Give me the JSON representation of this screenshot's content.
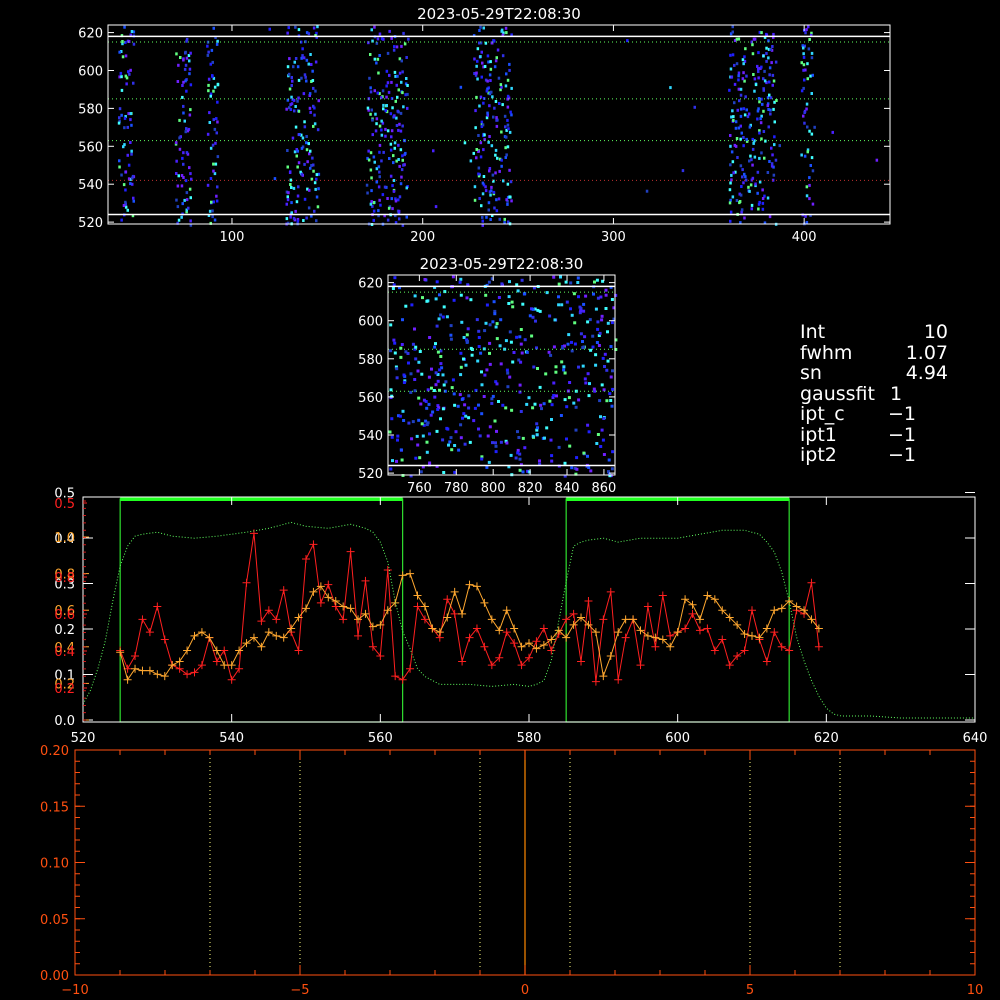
{
  "colors": {
    "background": "#000000",
    "axes": "#ffffff",
    "red_series": "#ff2020",
    "orange_series": "#ffa830",
    "green_profile": "#60ff60",
    "green_box": "#30e030",
    "green_bar": "#20ff20",
    "bottom_axes": "#ff5010",
    "bottom_line": "#ff8800",
    "guide_lines": "#ffff80",
    "dark_red_line": "#c03030"
  },
  "info": {
    "rows": [
      {
        "key": "Int",
        "value": "10"
      },
      {
        "key": "fwhm",
        "value": "1.07"
      },
      {
        "key": "sn",
        "value": "4.94"
      },
      {
        "key": "gaussfit",
        "value": "1"
      },
      {
        "key": "ipt_c",
        "value": "−1"
      },
      {
        "key": "ipt1",
        "value": "−1"
      },
      {
        "key": "ipt2",
        "value": "−1"
      }
    ]
  },
  "chart_data": [
    {
      "type": "heatmap",
      "title": "2023-05-29T22:08:30",
      "xlim": [
        35,
        445
      ],
      "ylim": [
        519,
        624
      ],
      "x_ticks": [
        "100",
        "200",
        "300",
        "400"
      ],
      "y_ticks": [
        "520",
        "540",
        "560",
        "580",
        "600",
        "620"
      ],
      "horizontal_lines_solid": [
        524,
        618
      ],
      "horizontal_lines_dotted": [
        563,
        585,
        615
      ],
      "horizontal_line_red_dotted": 542,
      "active_columns": [
        [
          40,
          48
        ],
        [
          70,
          78
        ],
        [
          86,
          92
        ],
        [
          128,
          145
        ],
        [
          170,
          192
        ],
        [
          226,
          246
        ],
        [
          360,
          385
        ],
        [
          398,
          404
        ]
      ]
    },
    {
      "type": "heatmap",
      "title": "2023-05-29T22:08:30",
      "xlim": [
        743,
        866
      ],
      "ylim": [
        519,
        624
      ],
      "x_ticks": [
        "760",
        "780",
        "800",
        "820",
        "840",
        "860"
      ],
      "y_ticks": [
        "520",
        "540",
        "560",
        "580",
        "600",
        "620"
      ],
      "horizontal_lines_solid": [
        524,
        618
      ],
      "horizontal_lines_dotted": [
        563,
        585,
        615
      ]
    },
    {
      "type": "line",
      "xlim": [
        520,
        640
      ],
      "x_ticks": [
        "520",
        "540",
        "560",
        "580",
        "600",
        "620",
        "640"
      ],
      "y_ticks_orange": [
        "0.0",
        "0.2",
        "0.4",
        "0.6",
        "0.8",
        "1.0"
      ],
      "y_ticks_red": [
        "0.2",
        "0.4",
        "0.6",
        "0.8",
        "0.5"
      ],
      "y_ticks_white": [
        "0.0",
        "0.1",
        "0.2",
        "0.3",
        "0.4",
        "0.5"
      ],
      "boxes": [
        [
          525,
          563
        ],
        [
          585,
          615
        ]
      ],
      "series": [
        {
          "color": "red",
          "x": [
            525,
            526,
            527,
            528,
            529,
            530,
            531,
            532,
            533,
            534,
            535,
            536,
            537,
            538,
            539,
            540,
            541,
            542,
            543,
            544,
            545,
            546,
            547,
            548,
            549,
            550,
            551,
            552,
            553,
            554,
            555,
            556,
            557,
            558,
            559,
            560,
            561,
            562,
            563,
            564,
            565,
            566,
            567,
            568,
            569,
            570,
            571,
            572,
            573,
            574,
            575,
            576,
            577,
            578,
            579,
            580,
            581,
            582,
            583,
            584,
            585,
            586,
            587,
            588,
            589,
            590,
            591,
            592,
            593,
            594,
            595,
            596,
            597,
            598,
            599,
            600,
            601,
            602,
            603,
            604,
            605,
            606,
            607,
            608,
            609,
            610,
            611,
            612,
            613,
            614,
            615,
            616,
            617,
            618,
            619
          ],
          "y": [
            0.38,
            0.28,
            0.35,
            0.55,
            0.48,
            0.62,
            0.44,
            0.3,
            0.28,
            0.25,
            0.26,
            0.3,
            0.45,
            0.32,
            0.38,
            0.22,
            0.28,
            0.75,
            1.02,
            0.54,
            0.6,
            0.55,
            0.71,
            0.48,
            0.38,
            0.88,
            0.96,
            0.64,
            0.74,
            0.62,
            0.55,
            0.92,
            0.46,
            0.76,
            0.4,
            0.35,
            0.82,
            0.24,
            0.22,
            0.28,
            0.62,
            0.55,
            0.5,
            0.45,
            0.66,
            0.58,
            0.32,
            0.45,
            0.5,
            0.4,
            0.3,
            0.34,
            0.48,
            0.42,
            0.3,
            0.34,
            0.43,
            0.5,
            0.38,
            0.47,
            0.55,
            0.58,
            0.32,
            0.65,
            0.21,
            0.55,
            0.7,
            0.22,
            0.45,
            0.55,
            0.3,
            0.62,
            0.4,
            0.68,
            0.46,
            0.48,
            0.5,
            0.58,
            0.49,
            0.5,
            0.38,
            0.44,
            0.3,
            0.35,
            0.38,
            0.6,
            0.44,
            0.32,
            0.48,
            0.4,
            0.38,
            0.6,
            0.58,
            0.75,
            0.4
          ]
        },
        {
          "color": "orange",
          "x": [
            525,
            526,
            527,
            528,
            529,
            530,
            531,
            532,
            533,
            534,
            535,
            536,
            537,
            538,
            539,
            540,
            541,
            542,
            543,
            544,
            545,
            546,
            547,
            548,
            549,
            550,
            551,
            552,
            553,
            554,
            555,
            556,
            557,
            558,
            559,
            560,
            561,
            562,
            563,
            564,
            565,
            566,
            567,
            568,
            569,
            570,
            571,
            572,
            573,
            574,
            575,
            576,
            577,
            578,
            579,
            580,
            581,
            582,
            583,
            584,
            585,
            586,
            587,
            588,
            589,
            590,
            591,
            592,
            593,
            594,
            595,
            596,
            597,
            598,
            599,
            600,
            601,
            602,
            603,
            604,
            605,
            606,
            607,
            608,
            609,
            610,
            611,
            612,
            613,
            614,
            615,
            616,
            617,
            618,
            619
          ],
          "y": [
            0.37,
            0.22,
            0.28,
            0.27,
            0.27,
            0.25,
            0.24,
            0.3,
            0.32,
            0.38,
            0.46,
            0.48,
            0.45,
            0.38,
            0.3,
            0.3,
            0.38,
            0.42,
            0.45,
            0.4,
            0.48,
            0.46,
            0.45,
            0.5,
            0.56,
            0.61,
            0.7,
            0.73,
            0.67,
            0.65,
            0.62,
            0.61,
            0.55,
            0.58,
            0.51,
            0.52,
            0.6,
            0.64,
            0.79,
            0.8,
            0.68,
            0.62,
            0.5,
            0.48,
            0.56,
            0.7,
            0.58,
            0.74,
            0.73,
            0.64,
            0.55,
            0.49,
            0.6,
            0.5,
            0.4,
            0.42,
            0.39,
            0.41,
            0.44,
            0.49,
            0.45,
            0.52,
            0.56,
            0.52,
            0.48,
            0.24,
            0.35,
            0.48,
            0.55,
            0.55,
            0.49,
            0.46,
            0.45,
            0.44,
            0.4,
            0.48,
            0.66,
            0.63,
            0.55,
            0.68,
            0.66,
            0.6,
            0.56,
            0.52,
            0.47,
            0.46,
            0.45,
            0.5,
            0.6,
            0.61,
            0.65,
            0.62,
            0.6,
            0.55,
            0.5
          ]
        },
        {
          "color": "green-dotted",
          "x": [
            520,
            521,
            522,
            523,
            524,
            525,
            526,
            527,
            528,
            530,
            532,
            535,
            538,
            540,
            542,
            545,
            548,
            550,
            553,
            556,
            558,
            559,
            560,
            561,
            562,
            563,
            564,
            565,
            566,
            567,
            568,
            570,
            572,
            575,
            578,
            580,
            581,
            582,
            583,
            584,
            585,
            586,
            587,
            588,
            590,
            592,
            595,
            598,
            600,
            603,
            606,
            609,
            611,
            612,
            613,
            614,
            615,
            616,
            617,
            618,
            619,
            620,
            621,
            622,
            623,
            624,
            626,
            630,
            635,
            640
          ],
          "y": [
            0.08,
            0.15,
            0.26,
            0.4,
            0.6,
            0.78,
            0.88,
            0.93,
            0.94,
            0.95,
            0.93,
            0.92,
            0.93,
            0.94,
            0.95,
            0.97,
            1.0,
            0.98,
            0.97,
            0.99,
            0.97,
            0.95,
            0.9,
            0.8,
            0.6,
            0.45,
            0.36,
            0.26,
            0.22,
            0.2,
            0.18,
            0.18,
            0.18,
            0.17,
            0.18,
            0.17,
            0.18,
            0.2,
            0.3,
            0.5,
            0.7,
            0.88,
            0.9,
            0.91,
            0.92,
            0.9,
            0.92,
            0.92,
            0.92,
            0.94,
            0.96,
            0.96,
            0.94,
            0.9,
            0.85,
            0.75,
            0.6,
            0.42,
            0.3,
            0.2,
            0.12,
            0.06,
            0.03,
            0.02,
            0.02,
            0.02,
            0.02,
            0.01,
            0.01,
            0.01
          ]
        }
      ]
    },
    {
      "type": "line",
      "xlim": [
        -10,
        10
      ],
      "ylim": [
        0.0,
        0.2
      ],
      "x_ticks": [
        "−10",
        "−5",
        "0",
        "5",
        "10"
      ],
      "y_ticks": [
        "0.00",
        "0.05",
        "0.10",
        "0.15",
        "0.20"
      ],
      "dotted_vlines": [
        -7,
        -5,
        -1,
        1,
        5,
        7
      ],
      "solid_vline": 0
    }
  ]
}
